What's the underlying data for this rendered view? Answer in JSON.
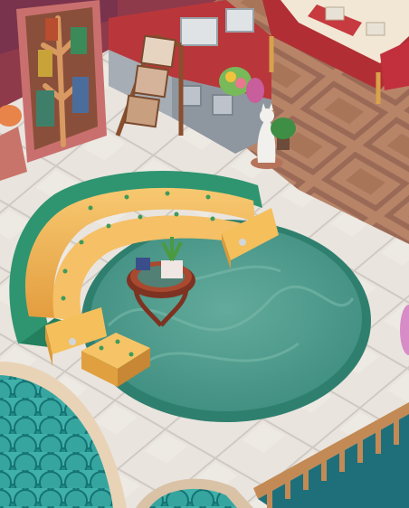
{
  "scene": {
    "type": "isometric-room",
    "description_hidden": true
  },
  "colors": {
    "wall": "#b9373a",
    "wall_trim": "#e7b07a",
    "floor_tile": "#e7e2dc",
    "floor_grout": "#c9c3bf",
    "wood_floor": "#b88468",
    "wood_floor_dark": "#9b6a56",
    "rug": "#4e9b8d",
    "rug_border": "#2f7f6e",
    "sofa_back": "#2e9570",
    "sofa_cushion": "#f3b756",
    "sofa_cushion_shade": "#d89a3d",
    "table_top": "#8d3a25",
    "railing": "#c38a55",
    "water": "#2d8f8f",
    "tablecloth": "#f1e7d4",
    "tablecloth_runner": "#b12e35"
  },
  "objects": [
    {
      "name": "bookshelf",
      "icon": "tree-bookshelf-icon"
    },
    {
      "name": "magazine-rack",
      "icon": "magazine-rack-icon"
    },
    {
      "name": "kitchen-counter",
      "icon": "counter-icon"
    },
    {
      "name": "flower-bouquet",
      "icon": "flower-icon"
    },
    {
      "name": "cat-statue",
      "icon": "cat-statue-icon"
    },
    {
      "name": "potted-plant",
      "icon": "plant-icon"
    },
    {
      "name": "dining-table",
      "icon": "dining-table-icon"
    },
    {
      "name": "curved-sofa",
      "icon": "sofa-icon"
    },
    {
      "name": "coffee-table",
      "icon": "coffee-table-icon"
    },
    {
      "name": "ottoman",
      "icon": "ottoman-icon"
    },
    {
      "name": "round-rug",
      "icon": "rug-icon"
    },
    {
      "name": "balcony-railing",
      "icon": "railing-icon"
    },
    {
      "name": "teal-roof",
      "icon": "roof-icon"
    }
  ]
}
